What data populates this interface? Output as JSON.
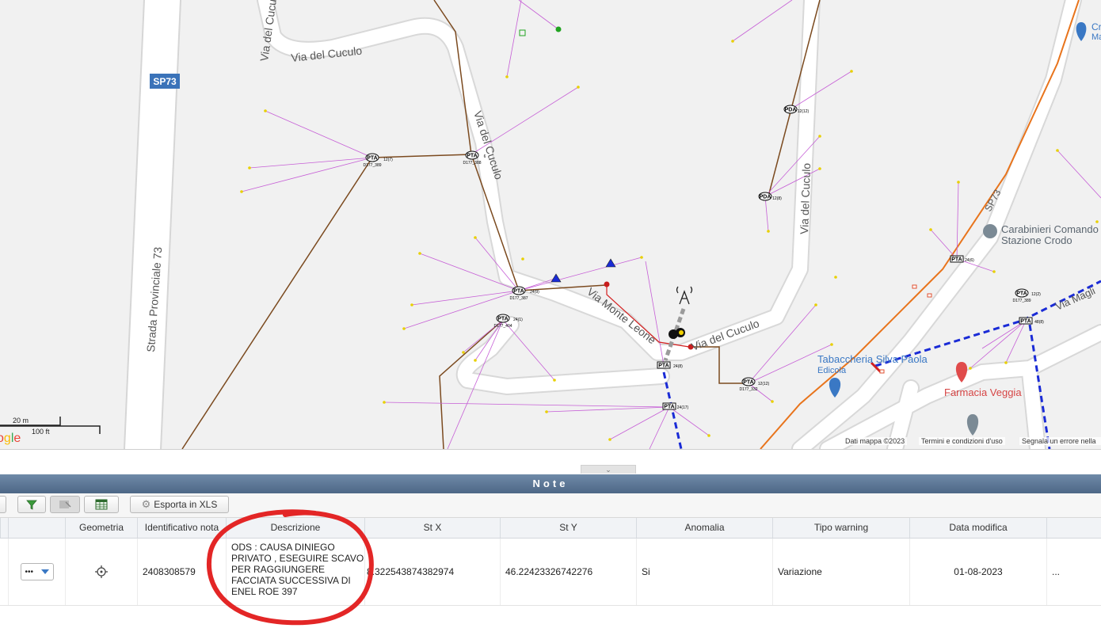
{
  "map": {
    "road_labels": {
      "sp73_shield": "SP73",
      "strada_provinciale": "Strada Provinciale 73",
      "via_del_cuculo_top": "Via del Cuculo",
      "via_del_cuculo_mid": "Via del Cuculo",
      "via_del_cuculo_right": "Via del Cuculo",
      "via_del_cuculo_bottom": "Via del Cuculo",
      "cuculo_fragment": "ulo",
      "via_monte_leone": "Via Monte Leone",
      "sp73_diagonal": "SP73",
      "via_magli": "Via Magli"
    },
    "pois": {
      "carabinieri_line1": "Carabinieri Comando",
      "carabinieri_line2": "Stazione Crodo",
      "tabaccheria": "Tabaccheria Silva Paola",
      "edicola": "Edicola",
      "farmacia": "Farmacia Veggia",
      "cr_line1": "Cr",
      "cr_line2": "Ma"
    },
    "nodes": [
      {
        "label": "PTA",
        "code": "D177_389",
        "count": "12(7)"
      },
      {
        "label": "PTA",
        "code": "D177_388",
        "count": "6"
      },
      {
        "label": "PTA",
        "code": "D177_387",
        "count": "24(9)"
      },
      {
        "label": "PTA",
        "code": "D177_404",
        "count": "24(1)"
      },
      {
        "label": "PTA",
        "code": "",
        "count": "24(8)"
      },
      {
        "label": "PTA",
        "code": "",
        "count": "24(17)"
      },
      {
        "label": "PTA",
        "code": "D177_332",
        "count": "12(12)"
      },
      {
        "label": "PDA",
        "code": "",
        "count": "12(12)"
      },
      {
        "label": "PDA",
        "code": "",
        "count": "12(8)"
      },
      {
        "label": "PTA",
        "code": "",
        "count": "24(6)"
      },
      {
        "label": "PTA",
        "code": "D177_389",
        "count": "12(2)"
      },
      {
        "label": "PTA",
        "code": "",
        "count": "48(8)"
      }
    ],
    "scale": {
      "metric": "20 m",
      "imperial": "100 ft"
    },
    "google_logo": "ogle",
    "attribution": {
      "data": "Dati mappa ©2023",
      "terms": "Termini e condizioni d'uso",
      "report": "Segnala un errore nella"
    },
    "colors": {
      "drop_line": "#c65fd6",
      "feeder": "#7b4a1f",
      "orange_line": "#e8741c",
      "dashed_blue": "#1a2bd6",
      "road": "#ffffff",
      "road_edge": "#d9d9d9",
      "shield": "#3b73b9",
      "farmacia": "#e04b4b"
    }
  },
  "panel": {
    "title": "Note",
    "export_label": "Esporta in XLS"
  },
  "table": {
    "columns": [
      "Geometria",
      "Identificativo nota",
      "Descrizione",
      "St X",
      "St Y",
      "Anomalia",
      "Tipo warning",
      "Data modifica"
    ],
    "row": {
      "actions": "•••",
      "id": "2408308579",
      "description": "ODS : CAUSA DINIEGO PRIVATO , ESEGUIRE SCAVO PER RAGGIUNGERE FACCIATA SUCCESSIVA DI ENEL ROE 397",
      "st_x": "8.322543874382974",
      "st_y": "46.22423326742276",
      "anomalia": "Si",
      "tipo_warning": "Variazione",
      "data_modifica": "01-08-2023",
      "more": "..."
    }
  }
}
